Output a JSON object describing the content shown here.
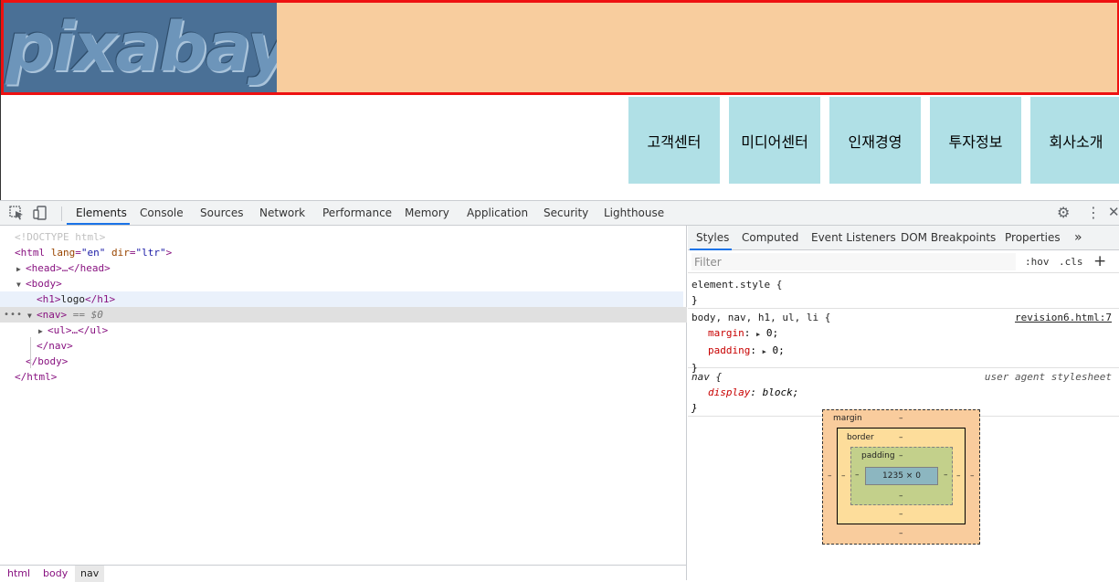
{
  "preview": {
    "logo_text": "pixabay",
    "nav_items": [
      "고객센터",
      "미디어센터",
      "인재경영",
      "투자정보",
      "회사소개"
    ]
  },
  "devtools": {
    "tabs": [
      "Elements",
      "Console",
      "Sources",
      "Network",
      "Performance",
      "Memory",
      "Application",
      "Security",
      "Lighthouse"
    ],
    "active_tab": "Elements",
    "dom": {
      "doctype": "<!DOCTYPE html>",
      "html_open_tag": "<html",
      "html_lang_name": "lang",
      "html_lang_value": "\"en\"",
      "html_dir_name": "dir",
      "html_dir_value": "\"ltr\"",
      "head": "<head>…</head>",
      "body_open": "<body>",
      "h1_open": "<h1>",
      "h1_text": "logo",
      "h1_close": "</h1>",
      "nav_open": "<nav>",
      "nav_selected_marker": "== $0",
      "ul": "<ul>…</ul>",
      "nav_close": "</nav>",
      "body_close": "</body>",
      "html_close": "</html>"
    },
    "breadcrumbs": [
      "html",
      "body",
      "nav"
    ],
    "styles": {
      "sub_tabs": [
        "Styles",
        "Computed",
        "Event Listeners",
        "DOM Breakpoints",
        "Properties"
      ],
      "more_tabs_glyph": "»",
      "filter_placeholder": "Filter",
      "hov": ":hov",
      "cls": ".cls",
      "element_style_selector": "element.style {",
      "close_brace": "}",
      "rule1_selector": "body, nav, h1, ul, li {",
      "rule1_source": "revision6.html:7",
      "rule1_props": [
        {
          "name": "margin",
          "value": "0;"
        },
        {
          "name": "padding",
          "value": "0;"
        }
      ],
      "rule2_selector": "nav {",
      "rule2_source": "user agent stylesheet",
      "rule2_prop_name": "display",
      "rule2_prop_value": "block;"
    },
    "box_model": {
      "margin_label": "margin",
      "border_label": "border",
      "padding_label": "padding",
      "dash": "–",
      "content_size": "1235 × 0"
    }
  }
}
